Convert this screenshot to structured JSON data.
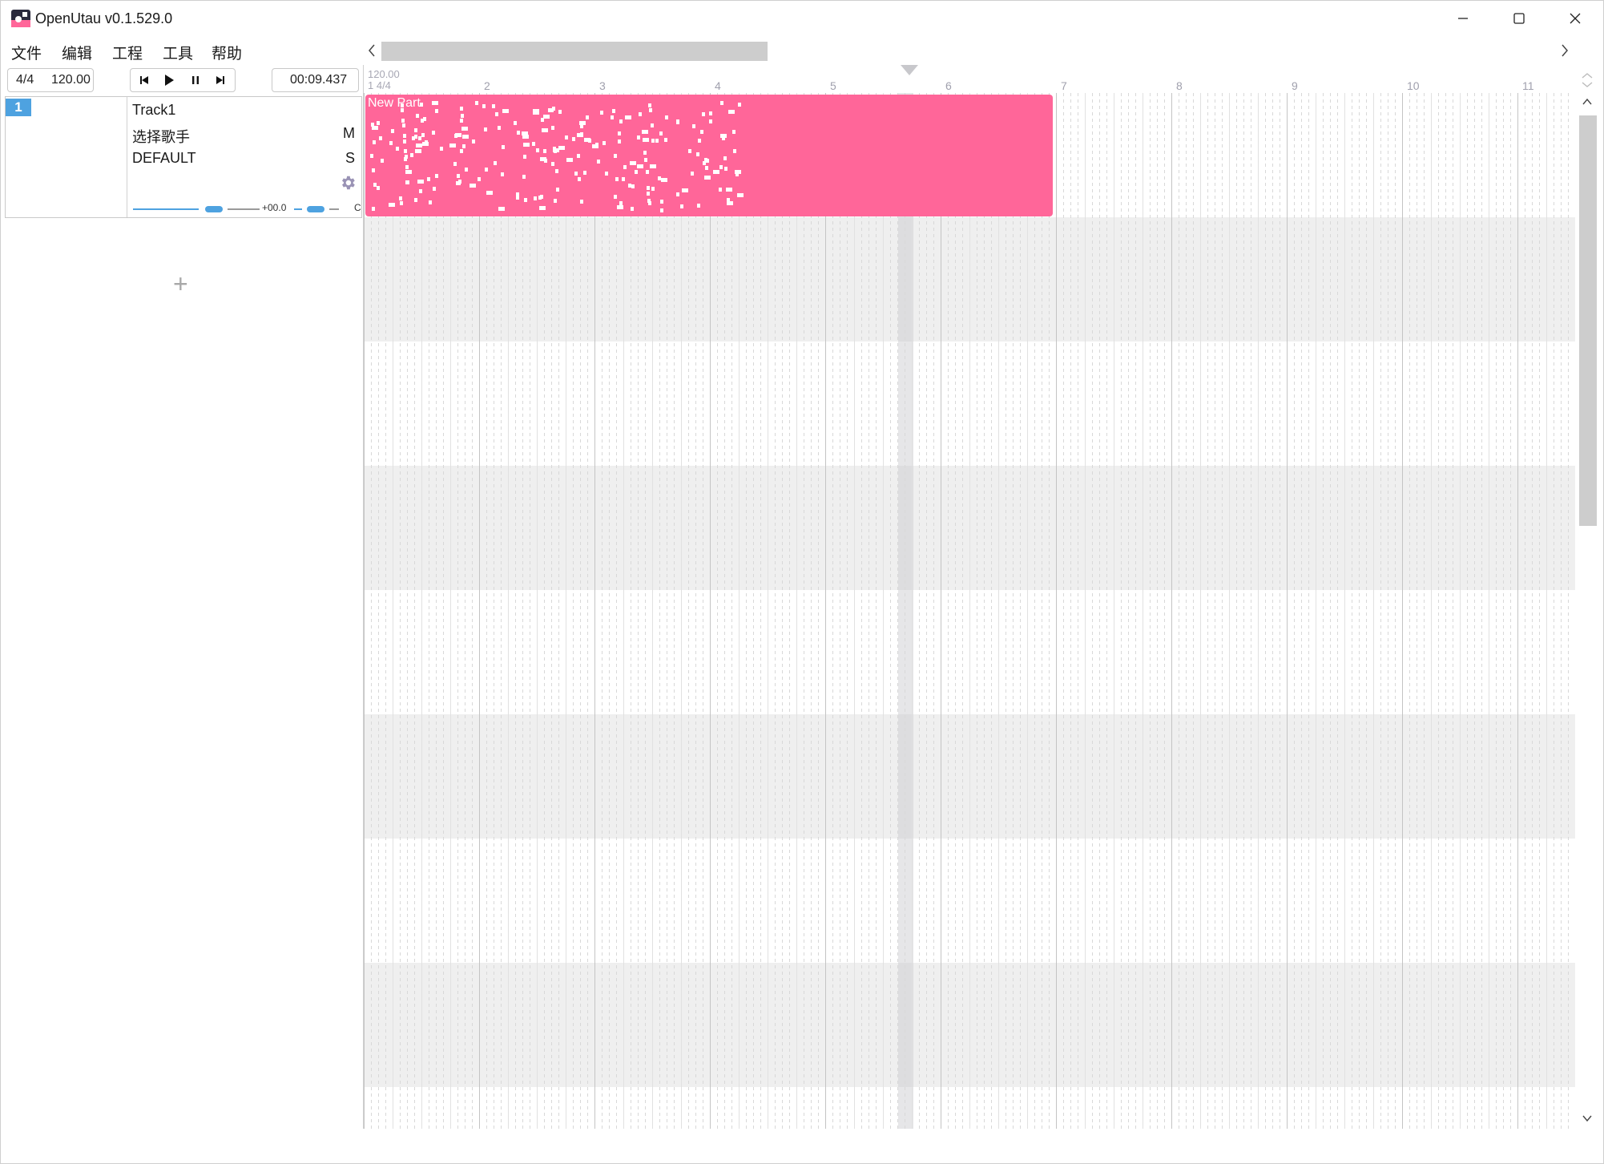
{
  "window": {
    "title": "OpenUtau v0.1.529.0",
    "icons": {
      "app": "openutau-app-icon",
      "minimize": "minimize-icon",
      "maximize": "maximize-icon",
      "close": "close-icon"
    }
  },
  "menu": [
    {
      "label": "文件"
    },
    {
      "label": "编辑"
    },
    {
      "label": "工程"
    },
    {
      "label": "工具"
    },
    {
      "label": "帮助"
    }
  ],
  "toolbar": {
    "time_signature": "4/4",
    "bpm": "120.00",
    "time_display": "00:09.437",
    "transport": [
      "skip-to-start-icon",
      "play-icon",
      "pause-icon",
      "skip-to-end-icon"
    ]
  },
  "track": {
    "number": "1",
    "name": "Track1",
    "singer": "选择歌手",
    "renderer": "DEFAULT",
    "mute": "M",
    "solo": "S",
    "pan": "+00.0",
    "pan_label": "C",
    "settings_icon": "gear-icon"
  },
  "add_track_label": "+",
  "ruler": {
    "bpm": "120.00",
    "signature": "1 4/4",
    "bars": [
      "2",
      "3",
      "4",
      "5",
      "6",
      "7",
      "8",
      "9",
      "10",
      "11"
    ]
  },
  "part": {
    "name": "New Part",
    "color": "#ff6699"
  },
  "colors": {
    "accent": "#4ea2e0",
    "part": "#ff6699",
    "scroll_thumb": "#cdcdcd"
  }
}
